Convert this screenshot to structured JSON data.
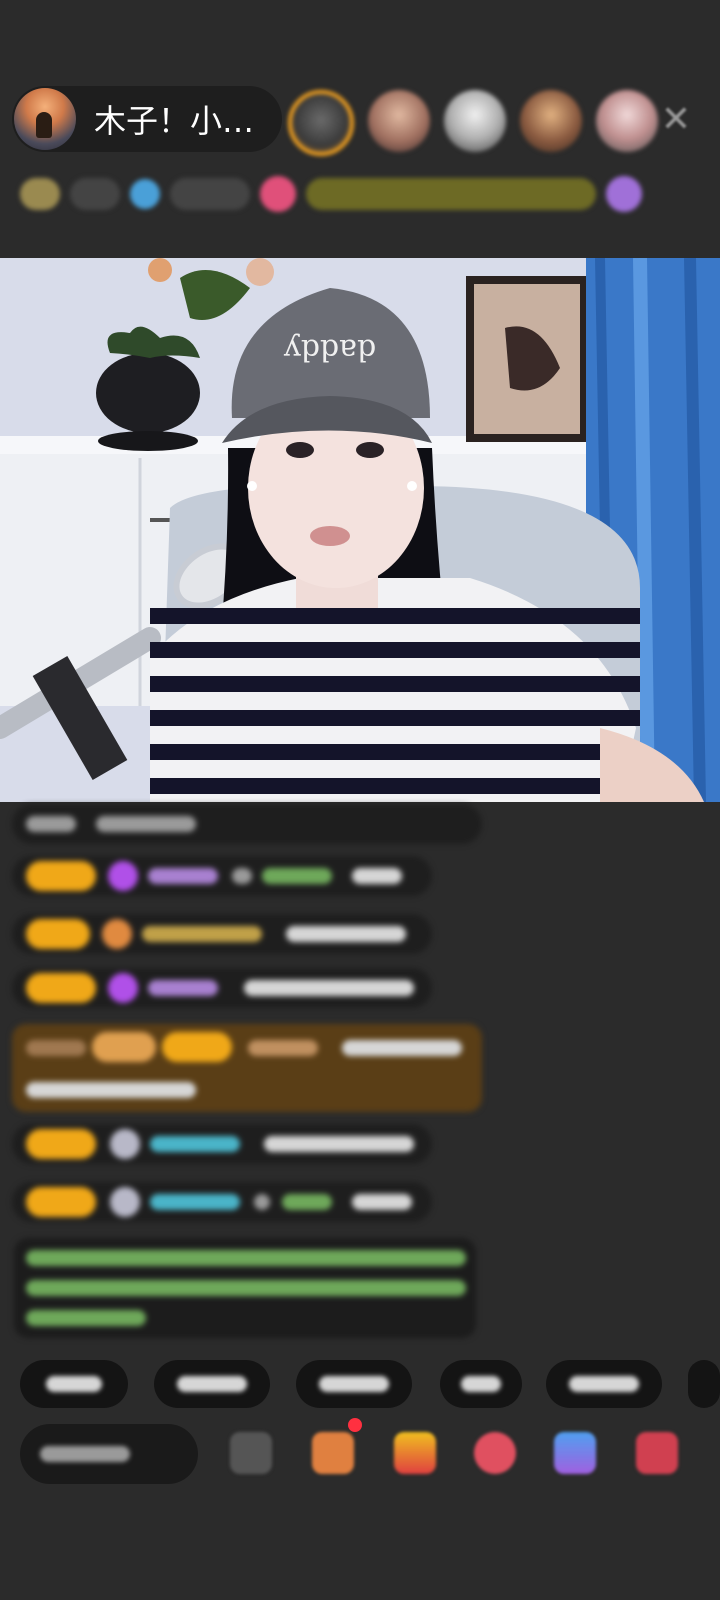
{
  "host": {
    "name": "木子！小…"
  },
  "header": {
    "close_icon": "close-icon"
  },
  "colors": {
    "background": "#2b2b2b",
    "badge": "#f0a818",
    "gift_message_bg": "#5a3e16",
    "viewer_highlight": "#f0a020"
  },
  "icons": {
    "close": "close-icon",
    "gift": "gift-icon",
    "share": "share-icon",
    "more": "more-icon"
  }
}
